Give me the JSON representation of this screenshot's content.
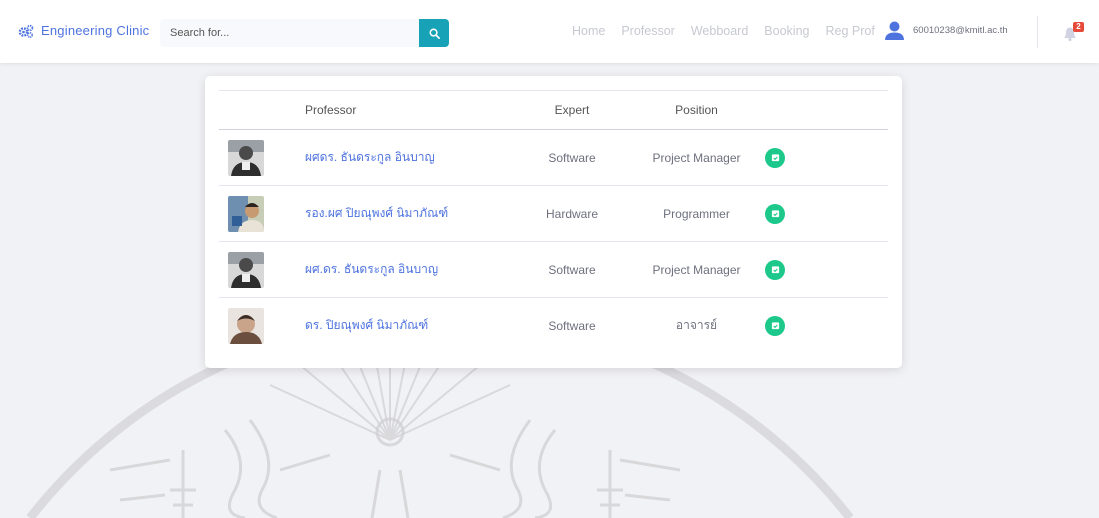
{
  "brand": {
    "name": "Engineering Clinic",
    "icon": "cogs-icon"
  },
  "search": {
    "placeholder": "Search for..."
  },
  "nav": {
    "items": [
      "Home",
      "Professor",
      "Webboard",
      "Booking",
      "Reg Prof"
    ]
  },
  "user": {
    "email": "60010238@kmitl.ac.th"
  },
  "notifications": {
    "count": "2"
  },
  "table": {
    "headers": {
      "photo": "",
      "professor": "Professor",
      "expert": "Expert",
      "position": "Position",
      "action": ""
    },
    "rows": [
      {
        "name": "ผศดร. ธันดระกูล อินบาญ",
        "expert": "Software",
        "position": "Project Manager"
      },
      {
        "name": "รอง.ผศ ปิยณุพงศ์ นิมาภัณฑ์",
        "expert": "Hardware",
        "position": "Programmer"
      },
      {
        "name": "ผศ.ดร. ธันดระกูล อินบาญ",
        "expert": "Software",
        "position": "Project Manager"
      },
      {
        "name": "ดร. ปิยณุพงศ์ นิมาภัณฑ์",
        "expert": "Software",
        "position": "อาจารย์"
      }
    ]
  },
  "colors": {
    "primary": "#4e73df",
    "info": "#17a2b8",
    "success": "#1cc88a",
    "danger": "#e74a3b"
  }
}
